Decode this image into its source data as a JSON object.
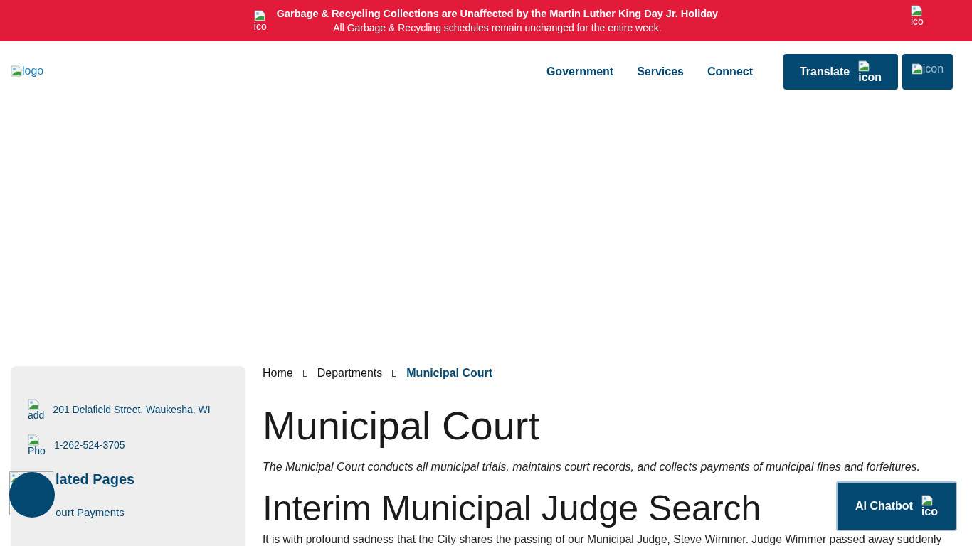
{
  "alert_banner": {
    "icon_alt": "ico",
    "title": "Garbage & Recycling Collections are Unaffected by the Martin Luther King Day Jr. Holiday",
    "message": "All Garbage & Recycling schedules remain unchanged for the entire week.",
    "close_alt": "ico"
  },
  "header": {
    "logo_alt": "logo",
    "nav": [
      {
        "label": "Government"
      },
      {
        "label": "Services"
      },
      {
        "label": "Connect"
      }
    ],
    "translate_button": {
      "label": "Translate",
      "icon_alt": "icon"
    },
    "icon_button": {
      "icon_alt": "icon"
    }
  },
  "sidebar": {
    "contacts": [
      {
        "icon_alt": "add",
        "text": "201 Delafield Street, Waukesha, WI"
      },
      {
        "icon_alt": "Pho",
        "text": "1-262-524-3705"
      }
    ],
    "heading": "lated Pages",
    "links": [
      {
        "label": "ourt Payments"
      }
    ]
  },
  "breadcrumb": [
    {
      "label": "Home",
      "current": false
    },
    {
      "label": "Departments",
      "current": false
    },
    {
      "label": "Municipal Court",
      "current": true
    }
  ],
  "page_title": "Municipal Court",
  "intro": "The Municipal Court conducts all municipal trials, maintains court records, and collects payments of municipal fines and forfeitures.",
  "section_title": "Interim Municipal Judge Search",
  "body": "It is with profound sadness that the City shares the passing of our Municipal Judge, Steve Wimmer. Judge Wimmer passed away suddenly",
  "chatbot_button": {
    "label": "AI Chatbot",
    "icon_alt": "ico"
  }
}
